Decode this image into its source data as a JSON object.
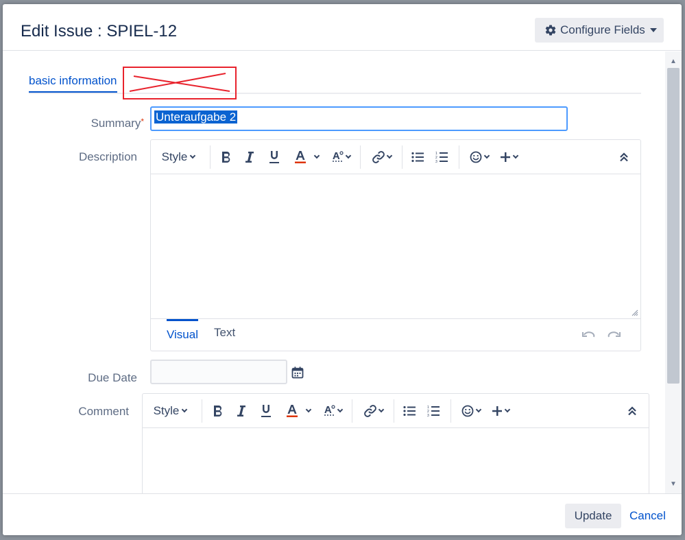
{
  "dialog": {
    "title": "Edit Issue : SPIEL-12",
    "configure_fields_label": "Configure Fields"
  },
  "tabs": {
    "basic": "basic information"
  },
  "fields": {
    "summary_label": "Summary",
    "summary_required": "*",
    "summary_value": "Unteraufgabe 2",
    "description_label": "Description",
    "due_date_label": "Due Date",
    "due_date_value": "",
    "comment_label": "Comment"
  },
  "editor": {
    "style_label": "Style",
    "mode_visual": "Visual",
    "mode_text": "Text"
  },
  "footer": {
    "update_label": "Update",
    "cancel_label": "Cancel"
  },
  "colors": {
    "accent": "#0052cc",
    "selection": "#0b63d1",
    "redaction": "#e8222c",
    "required": "#de350b"
  }
}
